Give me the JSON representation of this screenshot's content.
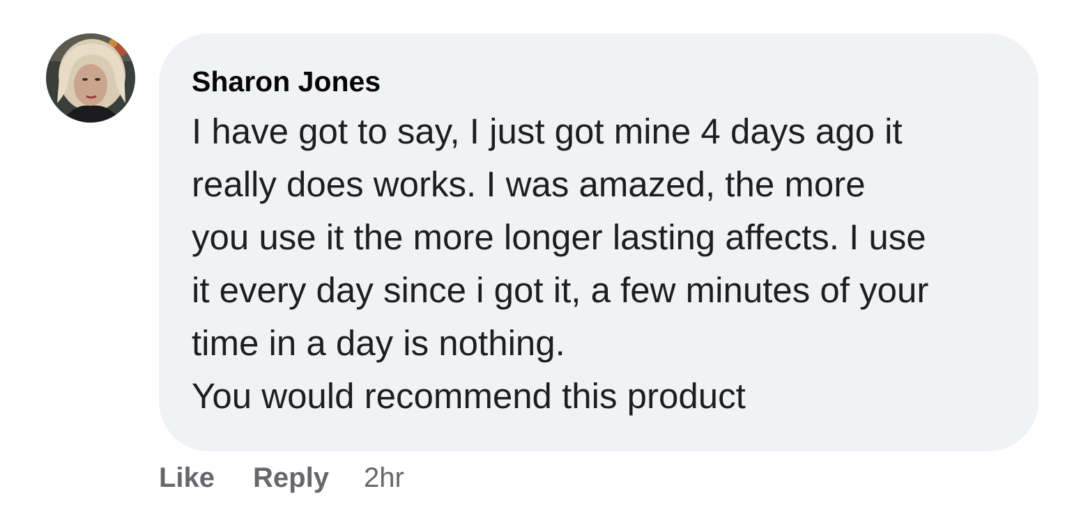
{
  "comment": {
    "author": "Sharon Jones",
    "avatar_icon": "profile-photo",
    "text_lines": [
      "I have got to say, I just got mine 4 days ago it",
      "really does works. I was amazed, the more",
      "you use it the more longer lasting affects. I use",
      "it every day since i got it, a few minutes of your",
      "time in a day is nothing.",
      "You would recommend this product"
    ],
    "actions": {
      "like_label": "Like",
      "reply_label": "Reply",
      "timestamp": "2hr"
    }
  },
  "colors": {
    "bubble_bg": "#f0f2f5",
    "author_text": "#050505",
    "body_text": "#1c1e21",
    "action_text": "#65676b"
  }
}
